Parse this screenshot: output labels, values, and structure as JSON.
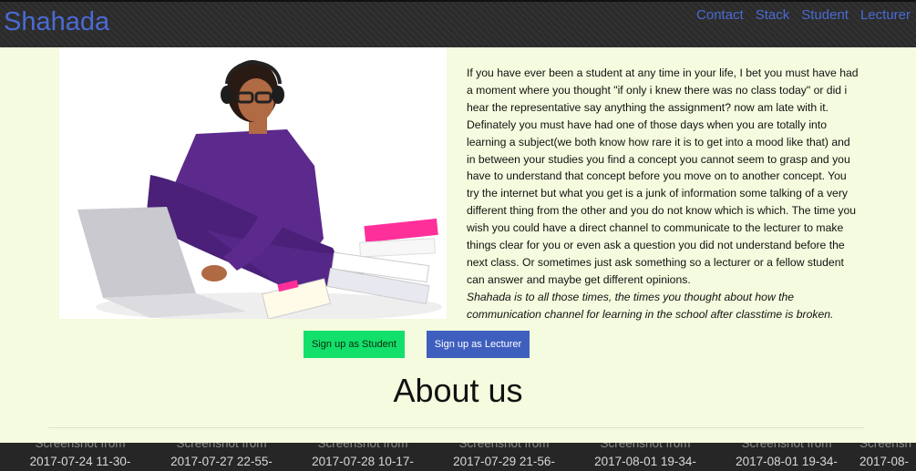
{
  "nav": {
    "brand": "Shahada",
    "links": [
      "Contact",
      "Stack",
      "Student",
      "Lecturer"
    ]
  },
  "intro": {
    "paragraph": "If you have ever been a student at any time in your life, I bet you must have had a moment where you thought \"if only i knew there was no class today\" or did i hear the representative say anything the assignment? now am late with it. Definately you must have had one of those days when you are totally into learning a subject(we both know how rare it is to get into a mood like that) and in between your studies you find a concept you cannot seem to grasp and you have to understand that concept before you move on to another concept. You try the internet but what you get is a junk of information some talking of a very different thing from the other and you do not know which is which. The time you wish you could have a direct channel to communicate to the lecturer to make things clear for you or even ask a question you did not understand before the next class. Or sometimes just ask something so a lecturer or a fellow student can answer and maybe get different opinions.",
    "tagline": "Shahada is to all those times, the times you thought about how the communication channel for learning in the school after classtime is broken."
  },
  "buttons": {
    "student": "Sign up as Student",
    "lecturer": "Sign up as Lecturer"
  },
  "about": {
    "heading": "About us"
  },
  "thumbnails": [
    {
      "line1": "Screenshot from",
      "line2": "2017-07-24 11-30-"
    },
    {
      "line1": "Screenshot from",
      "line2": "2017-07-27 22-55-"
    },
    {
      "line1": "Screenshot from",
      "line2": "2017-07-28 10-17-"
    },
    {
      "line1": "Screenshot from",
      "line2": "2017-07-29 21-56-"
    },
    {
      "line1": "Screenshot from",
      "line2": "2017-08-01 19-34-"
    },
    {
      "line1": "Screenshot from",
      "line2": "2017-08-01 19-34-"
    },
    {
      "line1": "Screensh",
      "line2": "2017-08-"
    }
  ],
  "colors": {
    "background": "#f4fbde",
    "navbar": "#2b2b2b",
    "link": "#4a6bd4",
    "student_button": "#12e06a",
    "lecturer_button": "#3f5fbf"
  }
}
